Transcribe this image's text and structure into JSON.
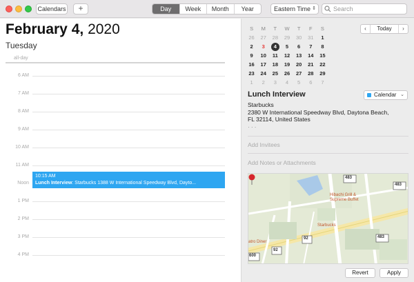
{
  "toolbar": {
    "calendars_label": "Calendars",
    "add_label": "+",
    "views": [
      "Day",
      "Week",
      "Month",
      "Year"
    ],
    "active_view": "Day",
    "timezone": "Eastern Time",
    "search_placeholder": "Search"
  },
  "day": {
    "month_day": "February 4,",
    "year": "2020",
    "weekday": "Tuesday",
    "allday_label": "all-day",
    "hours": [
      "6 AM",
      "7 AM",
      "8 AM",
      "9 AM",
      "10 AM",
      "11 AM",
      "Noon",
      "1 PM",
      "2 PM",
      "3 PM",
      "4 PM"
    ]
  },
  "event": {
    "time": "10:15 AM",
    "title": "Lunch Interview",
    "summary": ": Starbucks 1388 W International Speedway Blvd, Dayto...",
    "color": "#2ea6f1"
  },
  "mini_calendar": {
    "headers": [
      "S",
      "M",
      "T",
      "W",
      "T",
      "F",
      "S"
    ],
    "weeks": [
      [
        "26",
        "27",
        "28",
        "29",
        "30",
        "31",
        "1"
      ],
      [
        "2",
        "3",
        "4",
        "5",
        "6",
        "7",
        "8"
      ],
      [
        "9",
        "10",
        "11",
        "12",
        "13",
        "14",
        "15"
      ],
      [
        "16",
        "17",
        "18",
        "19",
        "20",
        "21",
        "22"
      ],
      [
        "23",
        "24",
        "25",
        "26",
        "27",
        "28",
        "29"
      ],
      [
        "1",
        "2",
        "3",
        "4",
        "5",
        "6",
        "7"
      ]
    ],
    "today_label": "Today",
    "prev_icon": "chevron-left-icon",
    "next_icon": "chevron-right-icon"
  },
  "inspector": {
    "title": "Lunch Interview",
    "calendar": "Calendar",
    "location_name": "Starbucks",
    "address_line1": "2380 W International Speedway Blvd, Daytona Beach,",
    "address_line2": "FL  32114, United States",
    "add_invitees": "Add Invitees",
    "add_notes": "Add Notes or Attachments",
    "revert_label": "Revert",
    "apply_label": "Apply"
  },
  "map": {
    "labels": [
      "Hibachi Grill & Supreme Buffet",
      "Starbucks",
      "atro Diner"
    ],
    "shields": [
      "483",
      "483",
      "92",
      "92",
      "92",
      "600",
      "600",
      "483"
    ]
  }
}
